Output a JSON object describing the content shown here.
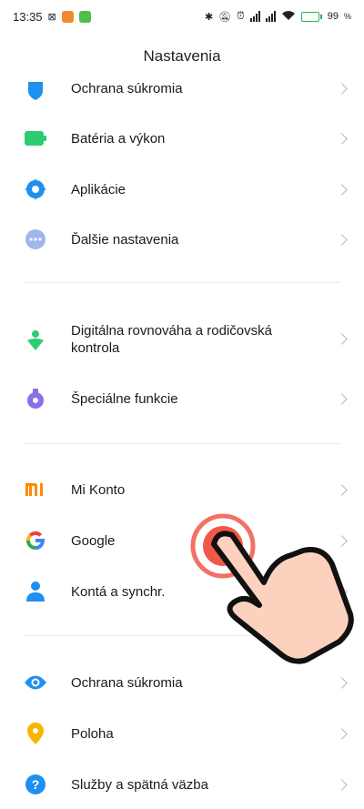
{
  "status": {
    "time": "13:35",
    "battery": "99"
  },
  "header": {
    "title": "Nastavenia"
  },
  "items": [
    {
      "label": "Ochrana súkromia",
      "icon": "privacy-shield-icon"
    },
    {
      "label": "Batéria a výkon",
      "icon": "battery-icon"
    },
    {
      "label": "Aplikácie",
      "icon": "apps-gear-icon"
    },
    {
      "label": "Ďalšie nastavenia",
      "icon": "more-dots-icon"
    },
    {
      "label": "Digitálna rovnováha a rodičovská",
      "label2": "kontrola",
      "icon": "digital-wellbeing-icon"
    },
    {
      "label": "Špeciálne funkcie",
      "icon": "special-features-icon"
    },
    {
      "label": "Mi Konto",
      "icon": "mi-logo-icon"
    },
    {
      "label": "Google",
      "icon": "google-logo-icon"
    },
    {
      "label": "Kontá a synchr.",
      "icon": "account-person-icon"
    },
    {
      "label": "Ochrana súkromia",
      "icon": "eye-icon"
    },
    {
      "label": "Poloha",
      "icon": "location-pin-icon"
    },
    {
      "label": "Služby a spätná väzba",
      "icon": "help-icon"
    }
  ],
  "colors": {
    "accent_blue": "#1f8ff0",
    "battery_green": "#2ecc71",
    "mi_orange": "#ff8a00",
    "tap_red": "#f0584a"
  }
}
